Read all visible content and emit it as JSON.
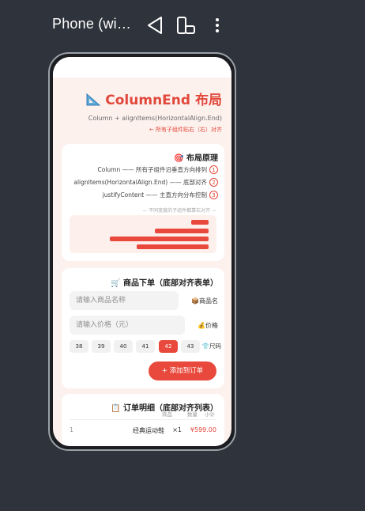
{
  "window": {
    "title": "Phone (wi…"
  },
  "icons": {
    "back": "back-triangle-icon",
    "rotate": "rotate-device-icon",
    "more": "more-vert-icon",
    "ruler": "triangle-ruler-icon",
    "dart": "dart-target-icon",
    "cart": "shopping-cart-icon",
    "package": "package-icon",
    "moneybag": "money-bag-icon",
    "shirt": "shirt-icon",
    "clipboard": "clipboard-icon"
  },
  "colors": {
    "accent": "#e8493c",
    "background": "#2f333b",
    "page": "#fdf1ee"
  },
  "hero": {
    "title": "ColumnEnd 布局",
    "subtitle": "Column + alignItems(HorizontalAlign.End)",
    "hint": "← 所有子组件贴右（右）对齐"
  },
  "principle": {
    "title": "布局原理",
    "rows": [
      {
        "text": "Column —— 所有子组件沿垂直方向排列",
        "num": "1"
      },
      {
        "text": "alignItems(HorizontalAlign.End) —— 底部对齐",
        "num": "2"
      },
      {
        "text": "justifyContent —— 主直方向分布控制",
        "num": "3"
      }
    ],
    "demo_caption": "— 不同宽度的子组件都靠右对齐 —",
    "bar_widths_pct": [
      13,
      41,
      75,
      55
    ]
  },
  "order": {
    "title": "商品下单（底部对齐表单）",
    "name_placeholder": "请输入商品名称",
    "name_label": "商品名",
    "price_placeholder": "请输入价格（元）",
    "price_label": "价格",
    "sizes": [
      "38",
      "39",
      "40",
      "41",
      "42",
      "43"
    ],
    "selected_size": "42",
    "size_label": "尺码",
    "add_button": "+ 添加到订单"
  },
  "order_list": {
    "title": "订单明细（底部对齐列表）",
    "headers": [
      "商品",
      "数量",
      "小计"
    ],
    "rows": [
      {
        "index": "1",
        "name": "经典运动鞋",
        "qty": "×1",
        "price": "¥599.00"
      }
    ]
  }
}
